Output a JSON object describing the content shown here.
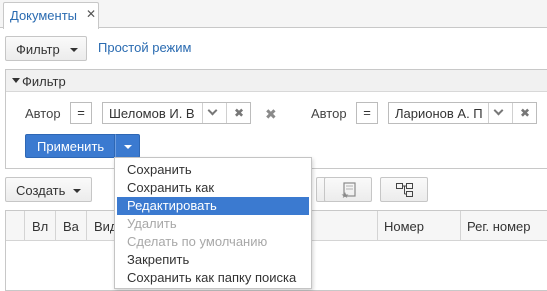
{
  "tabs": [
    {
      "label": "Документы",
      "close_icon": "close-icon"
    }
  ],
  "toolbar": {
    "filter_label": "Фильтр",
    "simple_mode_label": "Простой режим"
  },
  "filter_panel": {
    "title": "Фильтр",
    "conditions": [
      {
        "field": "Автор",
        "operator": "=",
        "value": "Шеломов И. В"
      },
      {
        "field": "Автор",
        "operator": "=",
        "value": "Ларионов А. П"
      }
    ],
    "apply_label": "Применить"
  },
  "toolbar2": {
    "create_label": "Создать"
  },
  "grid": {
    "columns": [
      "Вл",
      "Ва",
      "Вид",
      "Номер",
      "Рег. номер"
    ]
  },
  "menu": {
    "items": [
      {
        "label": "Сохранить",
        "state": "normal"
      },
      {
        "label": "Сохранить как",
        "state": "normal"
      },
      {
        "label": "Редактировать",
        "state": "active"
      },
      {
        "label": "Удалить",
        "state": "disabled"
      },
      {
        "label": "Сделать по умолчанию",
        "state": "disabled"
      },
      {
        "label": "Закрепить",
        "state": "normal"
      },
      {
        "label": "Сохранить как папку поиска",
        "state": "normal"
      }
    ]
  },
  "colors": {
    "accent": "#3b7ad0",
    "link": "#2a6bb1",
    "border": "#c8c8c8"
  }
}
